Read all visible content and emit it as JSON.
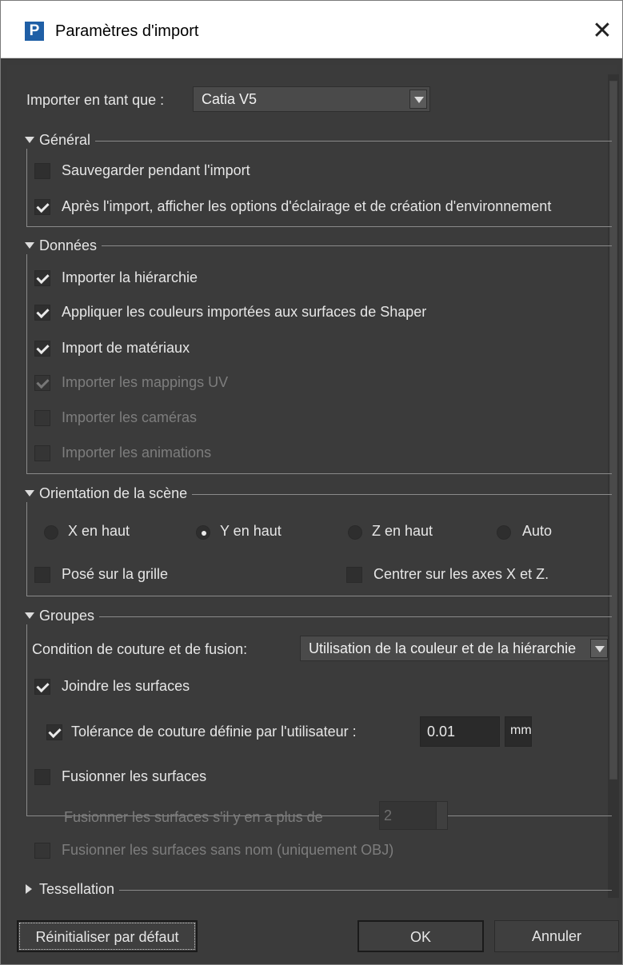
{
  "window": {
    "title": "Paramètres d'import",
    "app_icon_letter": "P",
    "close_glyph": "✕"
  },
  "import_as": {
    "label": "Importer en tant que :",
    "value": "Catia V5"
  },
  "general": {
    "title": "Général",
    "save_during_import": "Sauvegarder pendant l'import",
    "show_lighting_options": "Après l'import, afficher les options d'éclairage et de création d'environnement"
  },
  "data": {
    "title": "Données",
    "import_hierarchy": "Importer la hiérarchie",
    "apply_colors": "Appliquer les couleurs importées aux surfaces de Shaper",
    "import_materials": "Import de matériaux",
    "import_uv": "Importer les mappings UV",
    "import_cameras": "Importer les caméras",
    "import_animations": "Importer les animations"
  },
  "orientation": {
    "title": "Orientation de la scène",
    "x_up": "X en haut",
    "y_up": "Y en haut",
    "z_up": "Z en haut",
    "auto": "Auto",
    "on_grid": "Posé sur la grille",
    "center_axes": "Centrer sur les axes X et Z."
  },
  "groups": {
    "title": "Groupes",
    "condition_label": "Condition de couture et de fusion:",
    "condition_value": "Utilisation de la couleur et de la hiérarchie",
    "join_surfaces": "Joindre les surfaces",
    "tolerance_label": "Tolérance de couture définie par l'utilisateur :",
    "tolerance_value": "0.01",
    "tolerance_unit": "mm",
    "merge_surfaces": "Fusionner les surfaces",
    "merge_if_more_label": "Fusionner les surfaces s'il y en a plus de",
    "merge_if_more_value": "2",
    "merge_unnamed": "Fusionner les surfaces sans nom (uniquement OBJ)"
  },
  "tessellation": {
    "title": "Tessellation"
  },
  "footer": {
    "reset": "Réinitialiser par défaut",
    "ok": "OK",
    "cancel": "Annuler"
  }
}
